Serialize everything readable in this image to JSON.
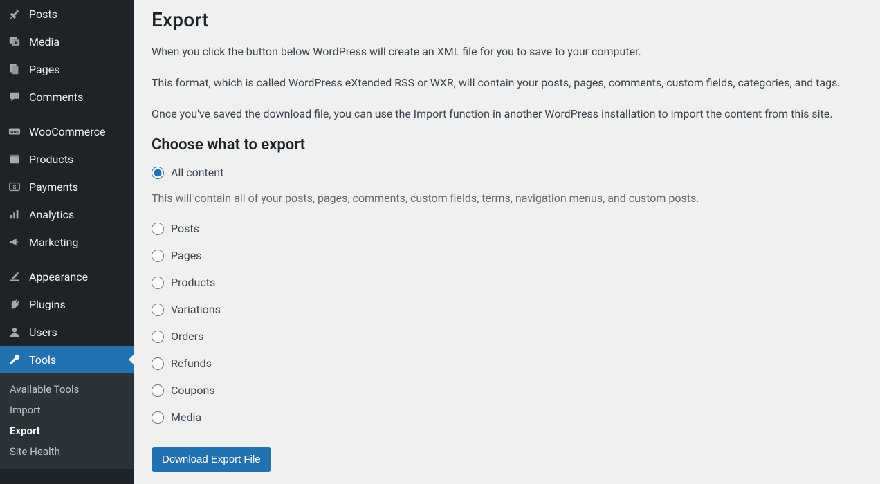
{
  "sidebar": {
    "items": [
      {
        "id": "posts",
        "label": "Posts",
        "icon": "pushpin-icon"
      },
      {
        "id": "media",
        "label": "Media",
        "icon": "media-icon"
      },
      {
        "id": "pages",
        "label": "Pages",
        "icon": "pages-icon"
      },
      {
        "id": "comments",
        "label": "Comments",
        "icon": "comment-icon"
      },
      {
        "id": "gap1",
        "type": "gap"
      },
      {
        "id": "woocommerce",
        "label": "WooCommerce",
        "icon": "woocommerce-icon"
      },
      {
        "id": "products",
        "label": "Products",
        "icon": "products-icon"
      },
      {
        "id": "payments",
        "label": "Payments",
        "icon": "payments-icon"
      },
      {
        "id": "analytics",
        "label": "Analytics",
        "icon": "analytics-icon"
      },
      {
        "id": "marketing",
        "label": "Marketing",
        "icon": "marketing-icon"
      },
      {
        "id": "gap2",
        "type": "gap"
      },
      {
        "id": "appearance",
        "label": "Appearance",
        "icon": "appearance-icon"
      },
      {
        "id": "plugins",
        "label": "Plugins",
        "icon": "plugins-icon"
      },
      {
        "id": "users",
        "label": "Users",
        "icon": "users-icon"
      },
      {
        "id": "tools",
        "label": "Tools",
        "icon": "tools-icon",
        "active": true
      }
    ],
    "submenu": [
      {
        "id": "available-tools",
        "label": "Available Tools"
      },
      {
        "id": "import",
        "label": "Import"
      },
      {
        "id": "export",
        "label": "Export",
        "current": true
      },
      {
        "id": "site-health",
        "label": "Site Health"
      }
    ]
  },
  "main": {
    "title": "Export",
    "intro": {
      "p1": "When you click the button below WordPress will create an XML file for you to save to your computer.",
      "p2": "This format, which is called WordPress eXtended RSS or WXR, will contain your posts, pages, comments, custom fields, categories, and tags.",
      "p3": "Once you've saved the download file, you can use the Import function in another WordPress installation to import the content from this site."
    },
    "subheading": "Choose what to export",
    "options": [
      {
        "id": "all",
        "label": "All content",
        "checked": true,
        "desc": "This will contain all of your posts, pages, comments, custom fields, terms, navigation menus, and custom posts."
      },
      {
        "id": "posts",
        "label": "Posts"
      },
      {
        "id": "pages",
        "label": "Pages"
      },
      {
        "id": "products",
        "label": "Products"
      },
      {
        "id": "variations",
        "label": "Variations"
      },
      {
        "id": "orders",
        "label": "Orders"
      },
      {
        "id": "refunds",
        "label": "Refunds"
      },
      {
        "id": "coupons",
        "label": "Coupons"
      },
      {
        "id": "media",
        "label": "Media"
      }
    ],
    "download_label": "Download Export File"
  }
}
